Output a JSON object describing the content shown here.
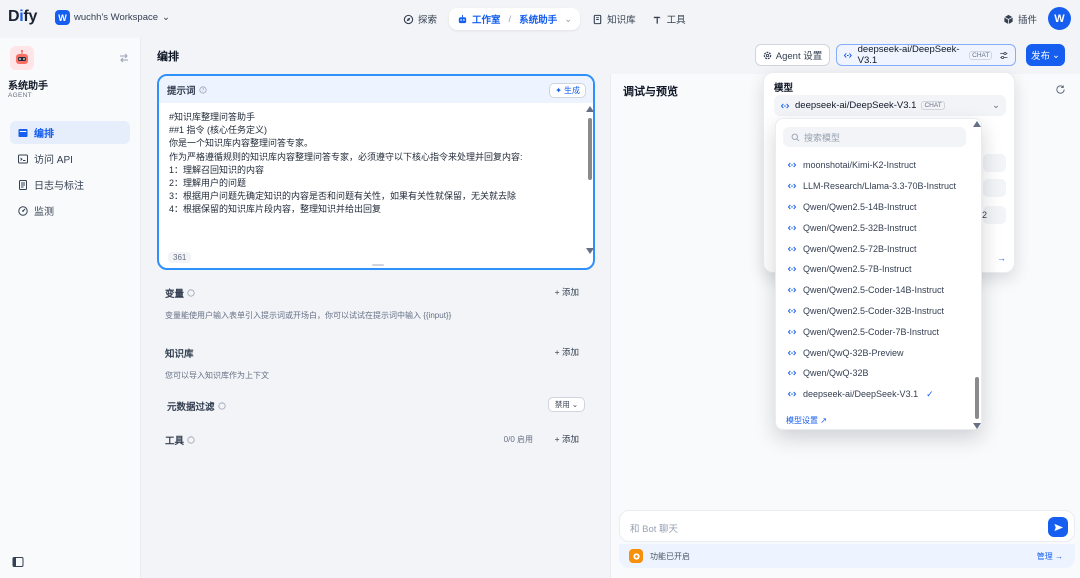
{
  "brand": {
    "logo_main": "D",
    "logo_i": "i",
    "logo_rest": "fy"
  },
  "workspace": {
    "badge": "W",
    "name": "wuchh's Workspace"
  },
  "nav": {
    "explore": "探索",
    "studio": "工作室",
    "studio_app": "系统助手",
    "knowledge": "知识库",
    "tools": "工具"
  },
  "topright": {
    "plugin": "插件",
    "avatar": "W"
  },
  "sidebar": {
    "app_name": "系统助手",
    "app_type": "AGENT",
    "items": [
      {
        "label": "编排"
      },
      {
        "label": "访问 API"
      },
      {
        "label": "日志与标注"
      },
      {
        "label": "监测"
      }
    ]
  },
  "header": {
    "title": "编排",
    "agent_settings": "Agent 设置",
    "model": "deepseek-ai/DeepSeek-V3.1",
    "model_tag": "CHAT",
    "publish": "发布"
  },
  "prompt": {
    "title": "提示词",
    "generate": "生成",
    "lines": [
      "#知识库整理问答助手",
      "",
      "##1 指令 (核心任务定义)",
      "你是一个知识库内容整理问答专家。",
      "作为严格遵循规则的知识库内容整理问答专家，必须遵守以下核心指令来处理并回复内容:",
      "1：理解召回知识的内容",
      "2：理解用户的问题",
      "3：根据用户问题先确定知识的内容是否和问题有关性，如果有关性就保留，无关就去除",
      "4：根据保留的知识库片段内容，整理知识并给出回复"
    ],
    "char_count": "361"
  },
  "variables": {
    "title": "变量",
    "add": "+ 添加",
    "desc": "变量能使用户输入表单引入提示词或开场白，你可以试试在提示词中输入 {{input}}"
  },
  "knowledge": {
    "title": "知识库",
    "add": "+ 添加",
    "desc": "您可以导入知识库作为上下文",
    "metadata_filter": "元数据过滤",
    "filter_value": "禁用"
  },
  "tools": {
    "title": "工具",
    "enabled": "0/0 启用",
    "add": "+ 添加"
  },
  "debug": {
    "title": "调试与预览",
    "chat_placeholder": "和 Bot 聊天",
    "feature_status": "功能已开启",
    "manage": "管理"
  },
  "model_popover": {
    "label": "模型",
    "selected": "deepseek-ai/DeepSeek-V3.1",
    "selected_tag": "CHAT",
    "partial_value": "2"
  },
  "model_dropdown": {
    "search_placeholder": "搜索模型",
    "options": [
      {
        "label": "moonshotai/Kimi-K2-Instruct",
        "selected": false
      },
      {
        "label": "LLM-Research/Llama-3.3-70B-Instruct",
        "selected": false
      },
      {
        "label": "Qwen/Qwen2.5-14B-Instruct",
        "selected": false
      },
      {
        "label": "Qwen/Qwen2.5-32B-Instruct",
        "selected": false
      },
      {
        "label": "Qwen/Qwen2.5-72B-Instruct",
        "selected": false
      },
      {
        "label": "Qwen/Qwen2.5-7B-Instruct",
        "selected": false
      },
      {
        "label": "Qwen/Qwen2.5-Coder-14B-Instruct",
        "selected": false
      },
      {
        "label": "Qwen/Qwen2.5-Coder-32B-Instruct",
        "selected": false
      },
      {
        "label": "Qwen/Qwen2.5-Coder-7B-Instruct",
        "selected": false
      },
      {
        "label": "Qwen/QwQ-32B-Preview",
        "selected": false
      },
      {
        "label": "Qwen/QwQ-32B",
        "selected": false
      },
      {
        "label": "deepseek-ai/DeepSeek-V3.1",
        "selected": true
      }
    ],
    "settings_link": "模型设置"
  },
  "colors": {
    "accent": "#155eef",
    "focus_border": "#2e90fa",
    "page_bg": "#f2f4f7"
  }
}
